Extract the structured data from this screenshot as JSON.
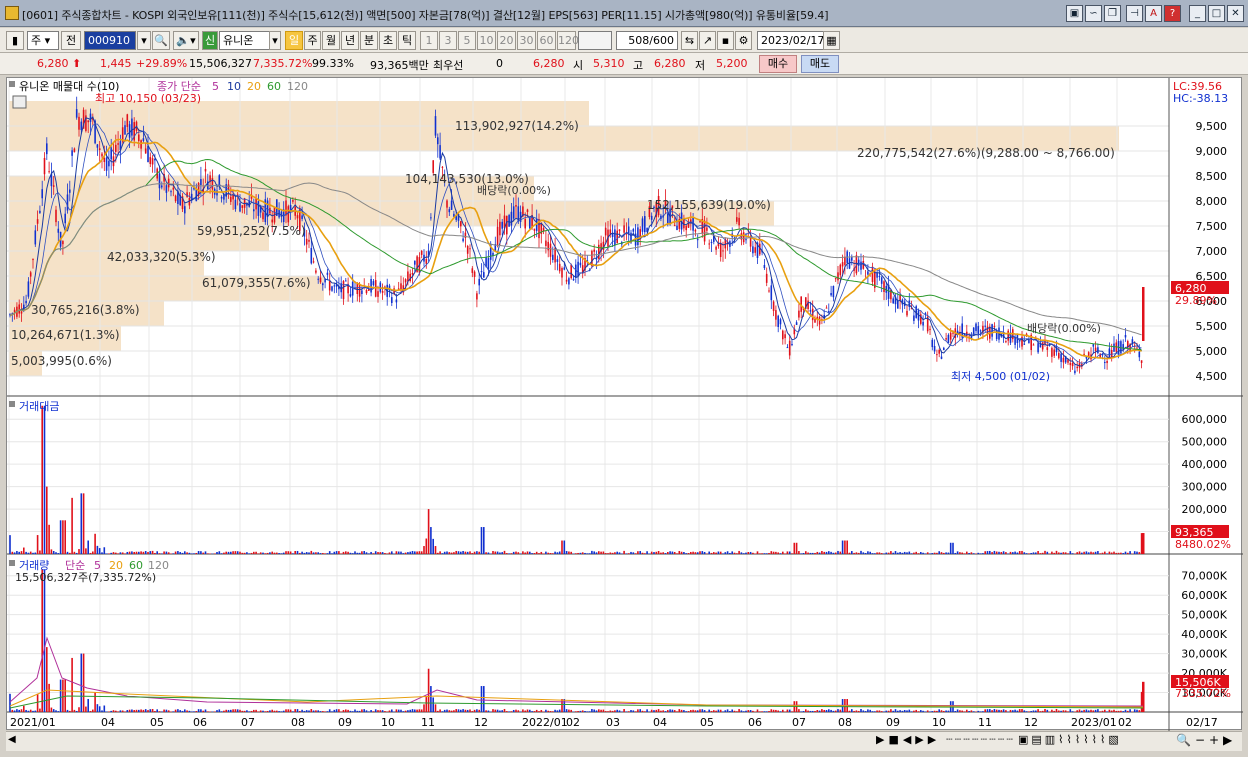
{
  "window": {
    "title": "[0601] 주식종합차트 - KOSPI 외국인보유[111(천)] 주식수[15,612(천)] 액면[500] 자본금[78(억)] 결산[12월] EPS[563] PER[11.15] 시가총액[980(억)] 유통비율[59.4]",
    "buttons": [
      "▣",
      "∽",
      "❐",
      "⊣",
      "A",
      "?",
      "_",
      "□",
      "✕"
    ]
  },
  "toolbar": {
    "period_mode": "주",
    "prev_label": "전",
    "code": "000910",
    "market_badge": "신",
    "stock_name": "유니온",
    "periods": [
      "일",
      "주",
      "월",
      "년",
      "분",
      "초",
      "틱"
    ],
    "active_period": "일",
    "intervals": [
      "1",
      "3",
      "5",
      "10",
      "20",
      "30",
      "60",
      "120"
    ],
    "count": "508",
    "count_total": "/600",
    "date": "2023/02/17"
  },
  "quote": {
    "price": "6,280",
    "change": "1,445",
    "change_pct": "+29.89%",
    "volume": "15,506,327",
    "volume_pct": "7,335.72%",
    "strength": "99.33%",
    "amount": "93,365백만",
    "pref_label": "최우선",
    "pref_value": "0",
    "ask": "6,280",
    "open_label": "시",
    "open": "5,310",
    "high_label": "고",
    "high": "6,280",
    "low_label": "저",
    "low": "5,200",
    "buy_label": "매수",
    "sell_label": "매도"
  },
  "price_panel": {
    "legend_title": "유니온 매물대 수(10)",
    "legend_ma_label": "종가 단순",
    "ma_periods": [
      "5",
      "10",
      "20",
      "60",
      "120"
    ],
    "high_marker": "최고 10,150 (03/23)",
    "low_marker": "최저 4,500 (01/02)",
    "dividend_labels": [
      "배당락(0.00%)",
      "배당락(0.00%)"
    ],
    "right_labels": [
      "LC:39.56",
      "HC:-38.13"
    ],
    "last_price_tag": "6,280",
    "last_pct_tag": "29.89%",
    "volume_profile_labels": [
      "5,003,995(0.6%)",
      "10,264,671(1.3%)",
      "30,765,216(3.8%)",
      "61,079,355(7.6%)",
      "42,033,320(5.3%)",
      "59,951,252(7.5%)",
      "104,143,530(13.0%)",
      "152,155,639(19.0%)",
      "113,902,927(14.2%)",
      "220,775,542(27.6%)(9,288.00 ~ 8,766.00)"
    ],
    "y_ticks": [
      "9,500",
      "9,000",
      "8,500",
      "8,000",
      "7,500",
      "7,000",
      "6,500",
      "6,000",
      "5,500",
      "5,000",
      "4,500"
    ]
  },
  "amount_panel": {
    "legend": "거래대금",
    "y_ticks": [
      "600,000",
      "500,000",
      "400,000",
      "300,000",
      "200,000",
      "100,000"
    ],
    "last_tag": "93,365",
    "last_pct": "8480.02%"
  },
  "volume_panel": {
    "legend": "거래량",
    "ma_label": "단순",
    "ma_periods": [
      "5",
      "20",
      "60",
      "120"
    ],
    "sub_legend": "15,506,327주(7,335.72%)",
    "y_ticks": [
      "70,000K",
      "60,000K",
      "50,000K",
      "40,000K",
      "30,000K",
      "20,000K",
      "10,000K"
    ],
    "last_tag": "15,506K",
    "last_pct": "7335.72%"
  },
  "x_axis": [
    "2021/01",
    "04",
    "05",
    "06",
    "07",
    "08",
    "09",
    "10",
    "11",
    "12",
    "2022/01",
    "02",
    "03",
    "04",
    "05",
    "06",
    "07",
    "08",
    "09",
    "10",
    "11",
    "12",
    "2023/01",
    "02",
    "02/17"
  ],
  "colors": {
    "up": "#e0101a",
    "down": "#1030d0",
    "ma5": "#1a3aa0",
    "ma20": "#e8a010",
    "ma60": "#2e9a2e",
    "ma120": "#888888",
    "profile": "#f5e2c8"
  }
}
